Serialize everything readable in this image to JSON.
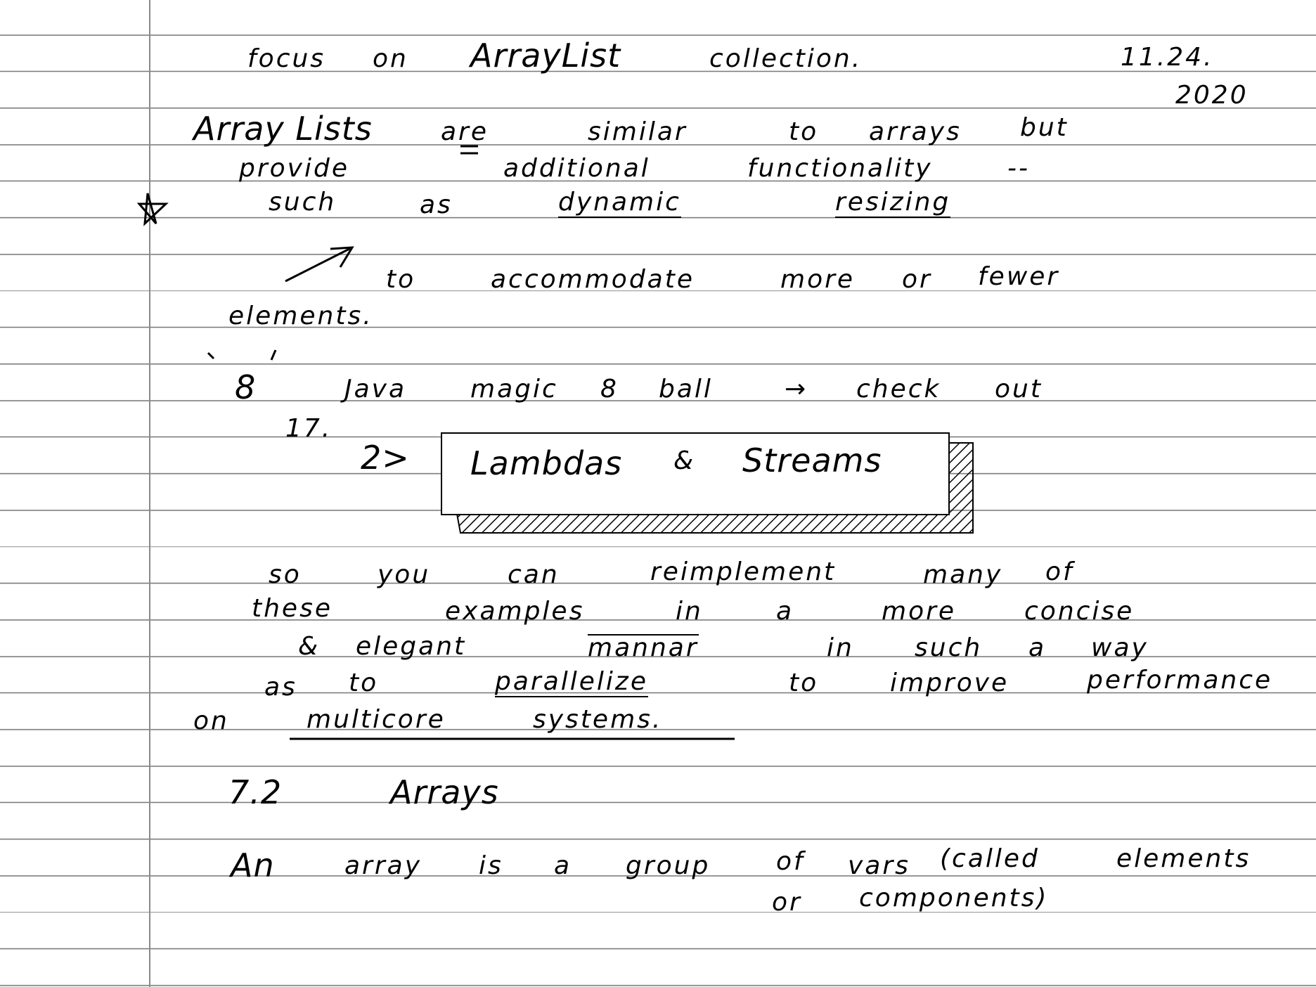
{
  "lines": [
    {
      "words": [
        "focus",
        "on",
        "ArrayList",
        "collection.",
        "11.24.",
        "2020"
      ]
    },
    {
      "words": [
        "Array Lists",
        "are",
        "similar",
        "to",
        "arrays",
        "but"
      ]
    },
    {
      "words": [
        "provide",
        "additional",
        "functionality",
        "--"
      ]
    },
    {
      "words": [
        "such",
        "as",
        "dynamic",
        "resizing"
      ]
    },
    {
      "words": [
        "to",
        "accommodate",
        "more",
        "or",
        "fewer"
      ]
    },
    {
      "words": [
        "elements."
      ]
    },
    {
      "words": [
        "8",
        "Java",
        "magic",
        "8",
        "ball",
        "→",
        "check",
        "out"
      ]
    },
    {
      "words": [
        "17.",
        "2>",
        "Lambdas",
        "&",
        "Streams"
      ]
    },
    {
      "words": [
        "so",
        "you",
        "can",
        "reimplement",
        "many",
        "of"
      ]
    },
    {
      "words": [
        "these",
        "examples",
        "in",
        "a",
        "more",
        "concise"
      ]
    },
    {
      "words": [
        "&",
        "elegant",
        "mannar",
        "in",
        "such",
        "a",
        "way"
      ]
    },
    {
      "words": [
        "as",
        "to",
        "parallelize",
        "to",
        "improve",
        "performance"
      ]
    },
    {
      "words": [
        "on",
        "multicore",
        "systems."
      ]
    },
    {
      "words": [
        "7.2",
        "Arrays"
      ]
    },
    {
      "words": [
        "An",
        "array",
        "is",
        "a",
        "group",
        "of",
        "vars",
        "(called",
        "elements"
      ]
    },
    {
      "words": [
        "or",
        "components)"
      ]
    }
  ]
}
